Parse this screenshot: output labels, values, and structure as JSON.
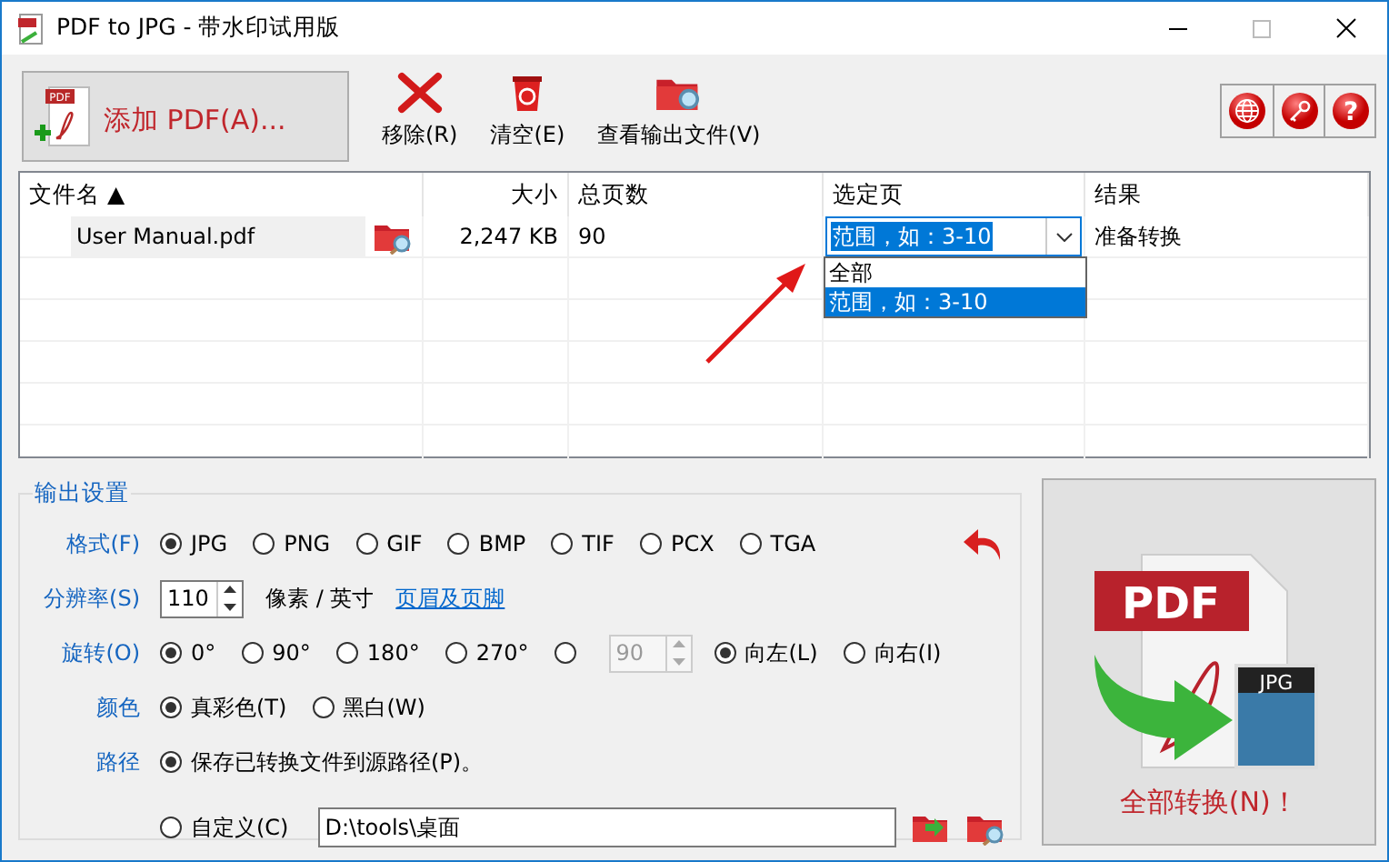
{
  "window": {
    "title": "PDF to JPG - 带水印试用版"
  },
  "toolbar": {
    "add_button": {
      "label": "添加 PDF(A)...",
      "icon_label": "PDF"
    },
    "buttons": [
      {
        "kind": "remove",
        "label": "移除(R)"
      },
      {
        "kind": "clear",
        "label": "清空(E)"
      },
      {
        "kind": "view",
        "label": "查看输出文件(V)"
      }
    ],
    "tool_icons": [
      {
        "kind": "globe"
      },
      {
        "kind": "key"
      },
      {
        "kind": "help",
        "glyph": "?"
      }
    ]
  },
  "table": {
    "columns": [
      {
        "label": "文件名",
        "sort_mark": "▲"
      },
      {
        "label": "大小"
      },
      {
        "label": "总页数"
      },
      {
        "label": "选定页"
      },
      {
        "label": "结果"
      }
    ],
    "rows": [
      {
        "file": "User Manual.pdf",
        "size": "2,247 KB",
        "pages": "90",
        "range": "范围，如：3-10",
        "result": "准备转换"
      }
    ],
    "dropdown": {
      "expanded": true,
      "options": [
        {
          "label": "全部",
          "selected": false
        },
        {
          "label": "范围，如：3-10",
          "selected": true
        }
      ]
    }
  },
  "output_settings": {
    "title": "输出设置",
    "format": {
      "label": "格式(F)",
      "options": [
        {
          "label": "JPG",
          "selected": true
        },
        {
          "label": "PNG",
          "selected": false
        },
        {
          "label": "GIF",
          "selected": false
        },
        {
          "label": "BMP",
          "selected": false
        },
        {
          "label": "TIF",
          "selected": false
        },
        {
          "label": "PCX",
          "selected": false
        },
        {
          "label": "TGA",
          "selected": false
        }
      ]
    },
    "resolution": {
      "label": "分辨率(S)",
      "value": "110",
      "unit": "像素 / 英寸",
      "link": "页眉及页脚"
    },
    "rotation": {
      "label": "旋转(O)",
      "options": [
        {
          "label": "0°",
          "selected": true
        },
        {
          "label": "90°",
          "selected": false
        },
        {
          "label": "180°",
          "selected": false
        },
        {
          "label": "270°",
          "selected": false
        }
      ],
      "custom": {
        "selected": false,
        "value": "90",
        "disabled": true
      },
      "direction": [
        {
          "label": "向左(L)",
          "selected": true
        },
        {
          "label": "向右(I)",
          "selected": false
        }
      ]
    },
    "color": {
      "label": "颜色",
      "options": [
        {
          "label": "真彩色(T)",
          "selected": true
        },
        {
          "label": "黑白(W)",
          "selected": false
        }
      ]
    },
    "path": {
      "label": "路径",
      "options": [
        {
          "label": "保存已转换文件到源路径(P)。",
          "selected": true
        },
        {
          "label": "自定义(C)",
          "selected": false
        }
      ],
      "value": "D:\\tools\\桌面"
    }
  },
  "convert_button": {
    "label": "全部转换(N)！",
    "logo_texts": [
      "PDF",
      "JPG"
    ]
  }
}
